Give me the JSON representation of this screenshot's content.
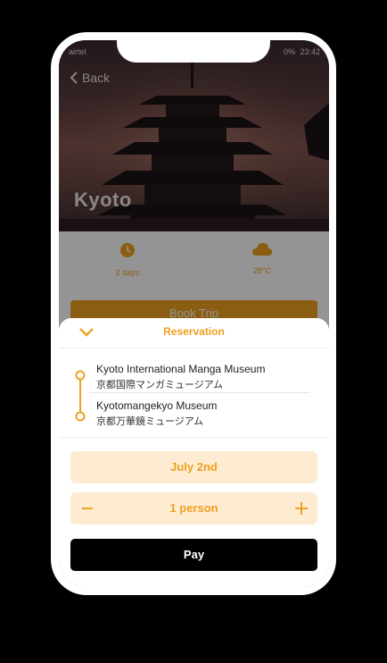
{
  "status": {
    "carrier": "airtel",
    "battery": "0%",
    "time": "23:42"
  },
  "nav": {
    "back_label": "Back"
  },
  "hero": {
    "city": "Kyoto"
  },
  "info": {
    "duration": "2 days",
    "temperature": "28°C"
  },
  "book_label": "Book Trip",
  "reservation": {
    "title": "Reservation",
    "stops": [
      {
        "name": "Kyoto International Manga Museum",
        "name_jp": "京都国際マンガミュージアム"
      },
      {
        "name": "Kyotomangekyo Museum",
        "name_jp": "京都万華鏡ミュージアム"
      }
    ],
    "date": "July 2nd",
    "guests": "1 person",
    "pay_label": "Pay"
  },
  "colors": {
    "accent": "#f0a020",
    "accent_light": "#fdecd2",
    "pay": "#000000"
  },
  "icons": [
    "back-chevron-icon",
    "clock-icon",
    "cloud-icon",
    "chevron-down-icon",
    "route-line-icon",
    "minus-icon",
    "plus-icon"
  ]
}
